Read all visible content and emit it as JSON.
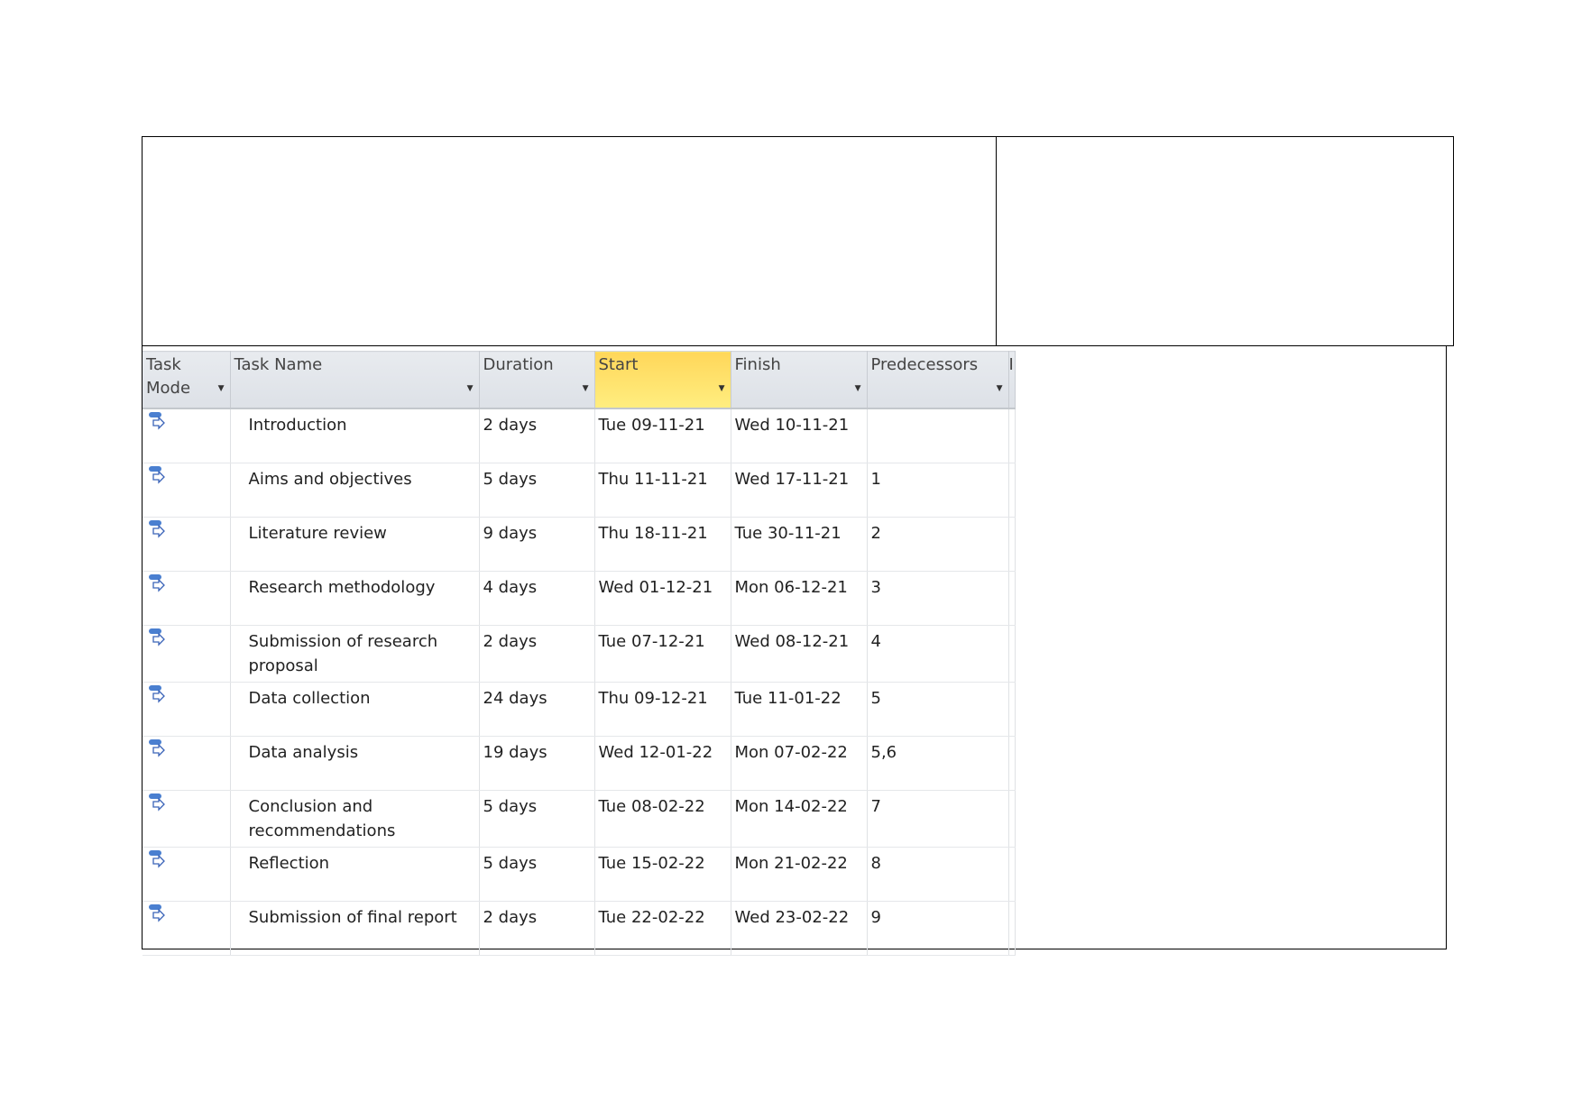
{
  "columns": [
    {
      "label": "Task Mode"
    },
    {
      "label": "Task Name"
    },
    {
      "label": "Duration"
    },
    {
      "label": "Start"
    },
    {
      "label": "Finish"
    },
    {
      "label": "Predecessors"
    },
    {
      "label": "I"
    }
  ],
  "accent_color": "#ffe066",
  "task_mode_icon": "auto-scheduled-task-icon",
  "rows": [
    {
      "name": "Introduction",
      "duration": "2 days",
      "start": "Tue 09-11-21",
      "finish": "Wed 10-11-21",
      "predecessors": ""
    },
    {
      "name": "Aims and objectives",
      "duration": "5 days",
      "start": "Thu 11-11-21",
      "finish": "Wed 17-11-21",
      "predecessors": "1"
    },
    {
      "name": "Literature review",
      "duration": "9 days",
      "start": "Thu 18-11-21",
      "finish": "Tue 30-11-21",
      "predecessors": "2"
    },
    {
      "name": "Research methodology",
      "duration": "4 days",
      "start": "Wed 01-12-21",
      "finish": "Mon 06-12-21",
      "predecessors": "3"
    },
    {
      "name": "Submission of research proposal",
      "duration": "2 days",
      "start": "Tue 07-12-21",
      "finish": "Wed 08-12-21",
      "predecessors": "4"
    },
    {
      "name": "Data collection",
      "duration": "24 days",
      "start": "Thu 09-12-21",
      "finish": "Tue 11-01-22",
      "predecessors": "5"
    },
    {
      "name": "Data analysis",
      "duration": "19 days",
      "start": "Wed 12-01-22",
      "finish": "Mon 07-02-22",
      "predecessors": "5,6"
    },
    {
      "name": "Conclusion and recommendations",
      "duration": "5 days",
      "start": "Tue 08-02-22",
      "finish": "Mon 14-02-22",
      "predecessors": "7"
    },
    {
      "name": "Reflection",
      "duration": "5 days",
      "start": "Tue 15-02-22",
      "finish": "Mon 21-02-22",
      "predecessors": "8"
    },
    {
      "name": "Submission of final report",
      "duration": "2 days",
      "start": "Tue 22-02-22",
      "finish": "Wed 23-02-22",
      "predecessors": "9"
    }
  ]
}
